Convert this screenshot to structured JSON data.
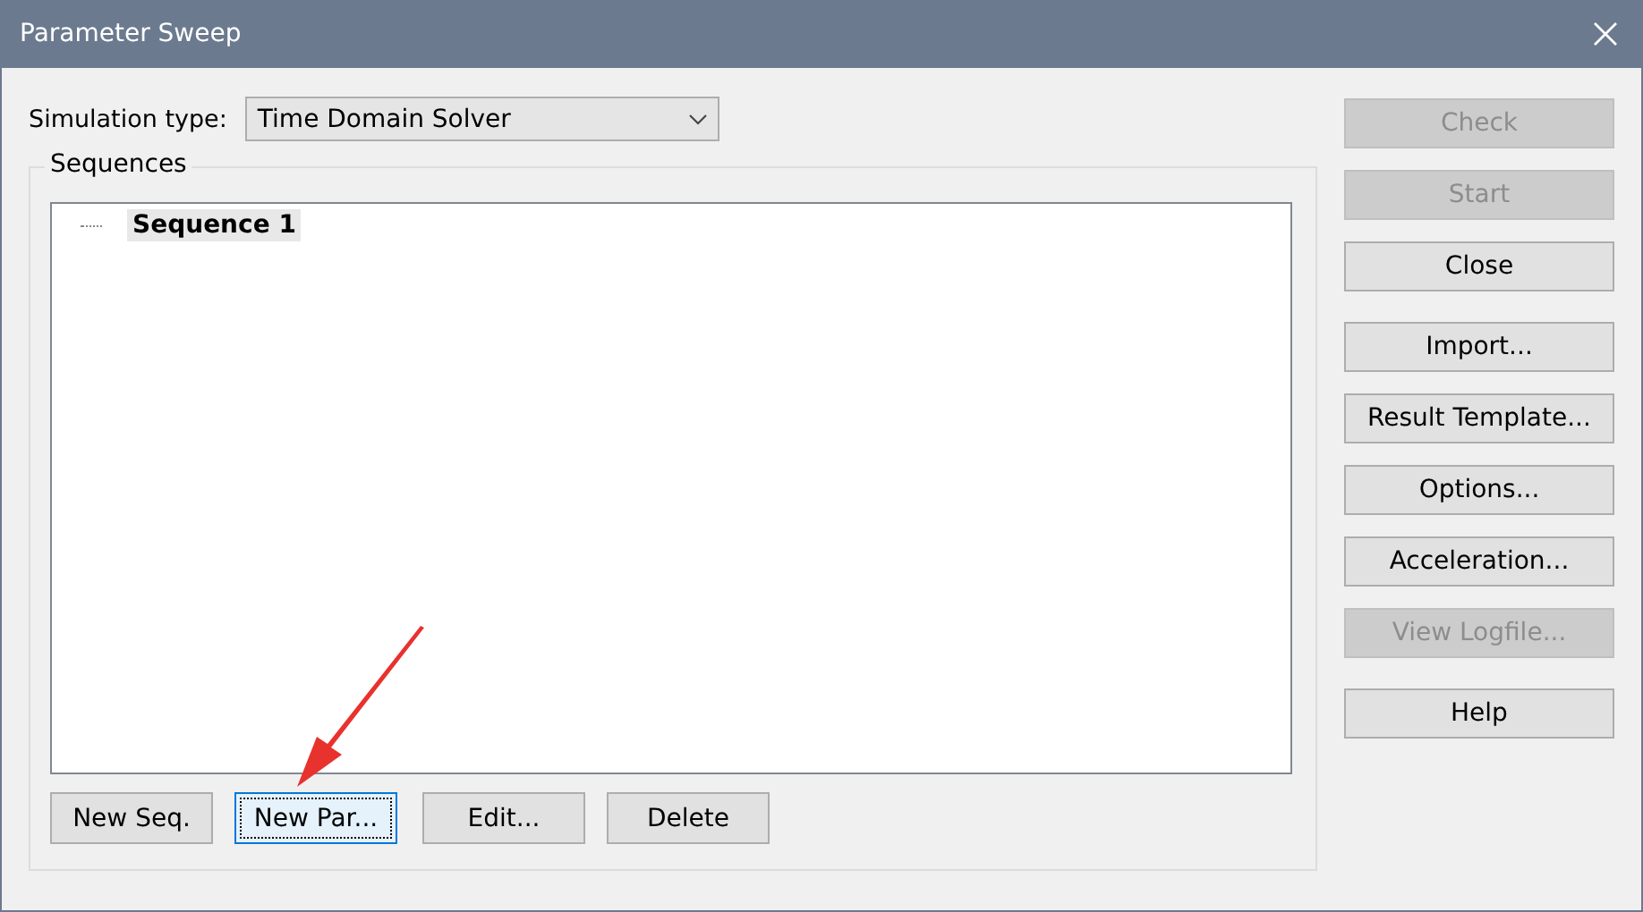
{
  "window": {
    "title": "Parameter Sweep"
  },
  "simulation_type": {
    "label": "Simulation type:",
    "value": "Time Domain Solver"
  },
  "sequences": {
    "label": "Sequences",
    "items": [
      {
        "label": "Sequence 1",
        "selected": true
      }
    ]
  },
  "list_buttons": [
    {
      "label": "New Seq.",
      "focused": false
    },
    {
      "label": "New Par...",
      "focused": true
    },
    {
      "label": "Edit...",
      "focused": false
    },
    {
      "label": "Delete",
      "focused": false
    }
  ],
  "side_button_groups": [
    [
      {
        "label": "Check",
        "disabled": true
      },
      {
        "label": "Start",
        "disabled": true
      },
      {
        "label": "Close",
        "disabled": false
      }
    ],
    [
      {
        "label": "Import...",
        "disabled": false
      },
      {
        "label": "Result Template...",
        "disabled": false
      },
      {
        "label": "Options...",
        "disabled": false
      },
      {
        "label": "Acceleration...",
        "disabled": false
      },
      {
        "label": "View Logfile...",
        "disabled": true
      }
    ],
    [
      {
        "label": "Help",
        "disabled": false
      }
    ]
  ]
}
